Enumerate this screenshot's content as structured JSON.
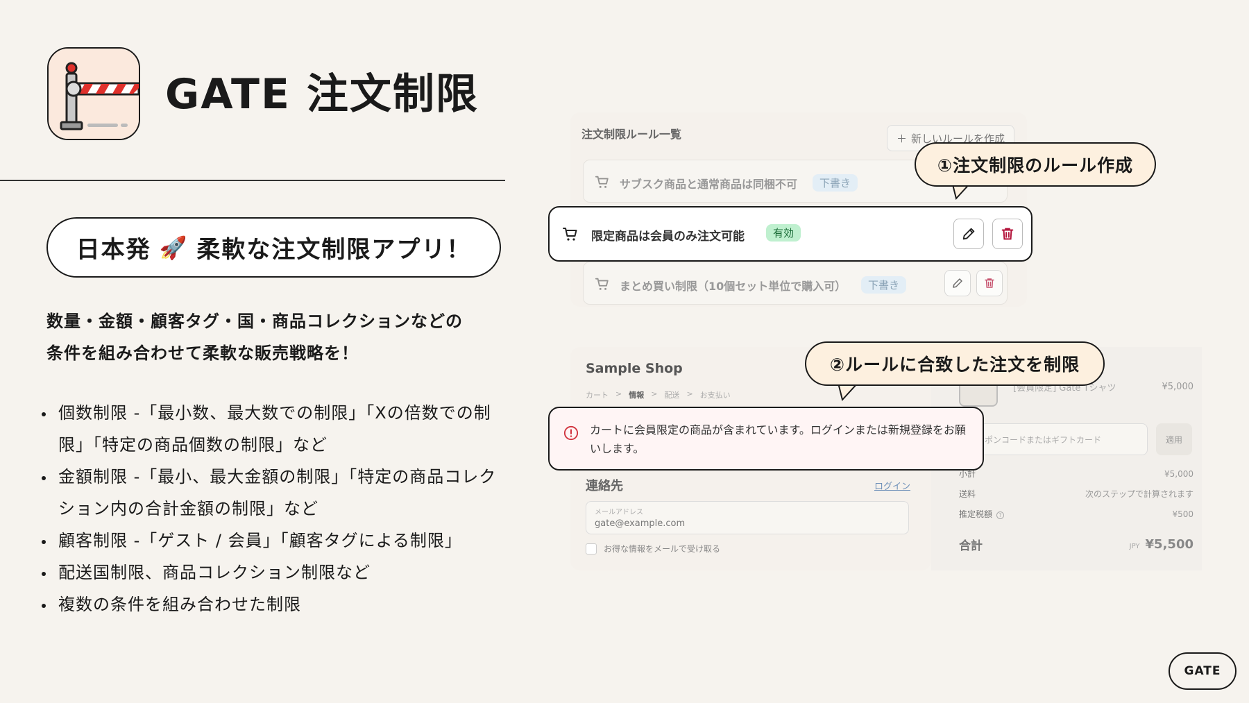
{
  "header": {
    "app_icon": "gate-barrier-icon",
    "title": "GATE 注文制限"
  },
  "tagline": {
    "before": "日本発",
    "emoji": "🚀",
    "after": "柔軟な注文制限アプリ！"
  },
  "description": {
    "line1": "数量・金額・顧客タグ・国・商品コレクションなどの",
    "line2": "条件を組み合わせて柔軟な販売戦略を！"
  },
  "features": [
    "個数制限 -「最小数、最大数での制限」「Xの倍数での制限」「特定の商品個数の制限」など",
    "金額制限 -「最小、最大金額の制限」「特定の商品コレクション内の合計金額の制限」など",
    "顧客制限 -「ゲスト / 会員」「顧客タグによる制限」",
    "配送国制限、商品コレクション制限など",
    "複数の条件を組み合わせた制限"
  ],
  "admin": {
    "title": "注文制限ルール一覧",
    "new_rule_button": "新しいルールを作成",
    "rules": [
      {
        "name": "サブスク商品と通常商品は同梱不可",
        "status": "下書き"
      },
      {
        "name": "限定商品は会員のみ注文可能",
        "status": "有効"
      },
      {
        "name": "まとめ買い制限（10個セット単位で購入可）",
        "status": "下書き"
      }
    ]
  },
  "callouts": {
    "first": "①注文制限のルール作成",
    "second": "②ルールに合致した注文を制限"
  },
  "checkout": {
    "shop_name": "Sample Shop",
    "breadcrumb": [
      "カート",
      "情報",
      "配送",
      "お支払い"
    ],
    "breadcrumb_sep": ">",
    "error_message": "カートに会員限定の商品が含まれています。ログインまたは新規登録をお願いします。",
    "contact_label": "連絡先",
    "login_link": "ログイン",
    "email_label": "メールアドレス",
    "email_value": "gate@example.com",
    "newsletter_label": "お得な情報をメールで受け取る"
  },
  "summary": {
    "product_name": "[会員限定] Gate Tシャツ",
    "product_price": "¥5,000",
    "coupon_placeholder": "ポンコードまたはギフトカード",
    "apply_button": "適用",
    "subtotal_label": "小計",
    "subtotal_value": "¥5,000",
    "shipping_label": "送料",
    "shipping_value": "次のステップで計算されます",
    "tax_label": "推定税額",
    "tax_value": "¥500",
    "total_label": "合計",
    "total_currency": "JPY",
    "total_value": "¥5,500"
  },
  "footer": {
    "badge": "GATE"
  },
  "colors": {
    "background": "#f6f3ee",
    "callout_fill": "#fdf0df",
    "active_badge": "#bff0cf",
    "draft_badge": "#e3eef6",
    "delete_red": "#b3123a",
    "error_red": "#d0313b",
    "barrier_red": "#e0312c"
  }
}
